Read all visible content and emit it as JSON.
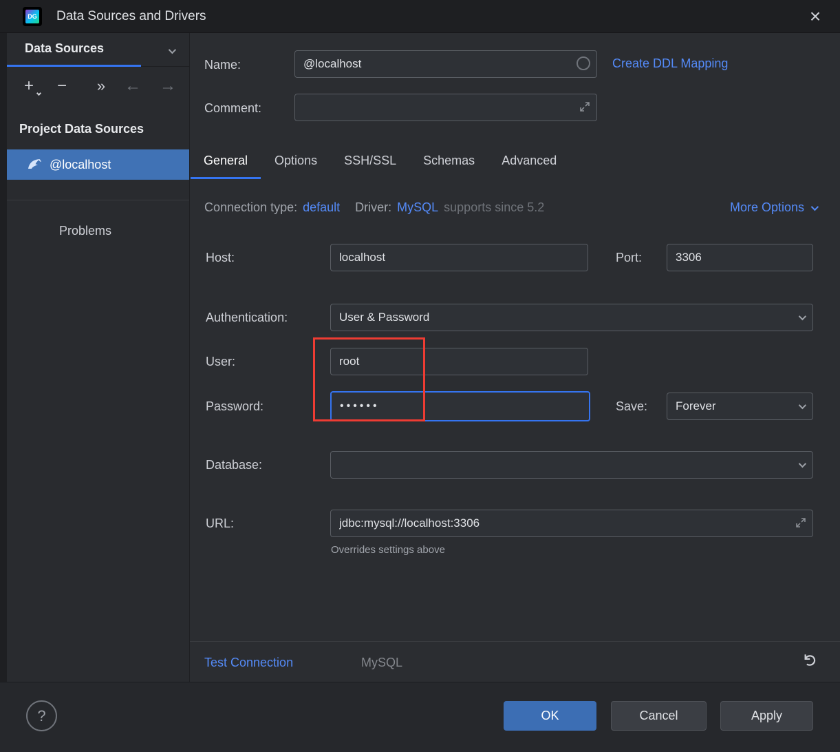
{
  "window": {
    "title": "Data Sources and Drivers",
    "logo_text": "DG",
    "close_glyph": "×"
  },
  "sidebar": {
    "header": "Data Sources",
    "toolbar": {
      "add_glyph": "+",
      "remove_glyph": "−",
      "more_glyph": "»",
      "back_glyph": "←",
      "forward_glyph": "→"
    },
    "section_title": "Project Data Sources",
    "selected_item": "@localhost",
    "problems_label": "Problems"
  },
  "header": {
    "name_label": "Name:",
    "name_value": "@localhost",
    "ddl_link": "Create DDL Mapping",
    "comment_label": "Comment:",
    "comment_value": ""
  },
  "tabs": [
    {
      "label": "General",
      "active": true
    },
    {
      "label": "Options",
      "active": false
    },
    {
      "label": "SSH/SSL",
      "active": false
    },
    {
      "label": "Schemas",
      "active": false
    },
    {
      "label": "Advanced",
      "active": false
    }
  ],
  "general": {
    "connection_type_label": "Connection type:",
    "connection_type_value": "default",
    "driver_label": "Driver:",
    "driver_value": "MySQL",
    "driver_note": "supports since 5.2",
    "more_options_label": "More Options",
    "host_label": "Host:",
    "host_value": "localhost",
    "port_label": "Port:",
    "port_value": "3306",
    "auth_label": "Authentication:",
    "auth_value": "User & Password",
    "user_label": "User:",
    "user_value": "root",
    "password_label": "Password:",
    "password_value": "••••••",
    "save_label": "Save:",
    "save_value": "Forever",
    "database_label": "Database:",
    "database_value": "",
    "url_label": "URL:",
    "url_value": "jdbc:mysql://localhost:3306",
    "url_note": "Overrides settings above"
  },
  "bottom_bar": {
    "test_connection": "Test Connection",
    "driver_name": "MySQL"
  },
  "buttons": {
    "help_glyph": "?",
    "ok": "OK",
    "cancel": "Cancel",
    "apply": "Apply"
  },
  "colors": {
    "accent": "#3574f0",
    "link": "#548af7",
    "selection": "#4072b5",
    "annotation_red": "#ee3c33",
    "ok_button": "#3c6eb4",
    "panel": "#2b2d31",
    "titlebar": "#1e1f22"
  }
}
